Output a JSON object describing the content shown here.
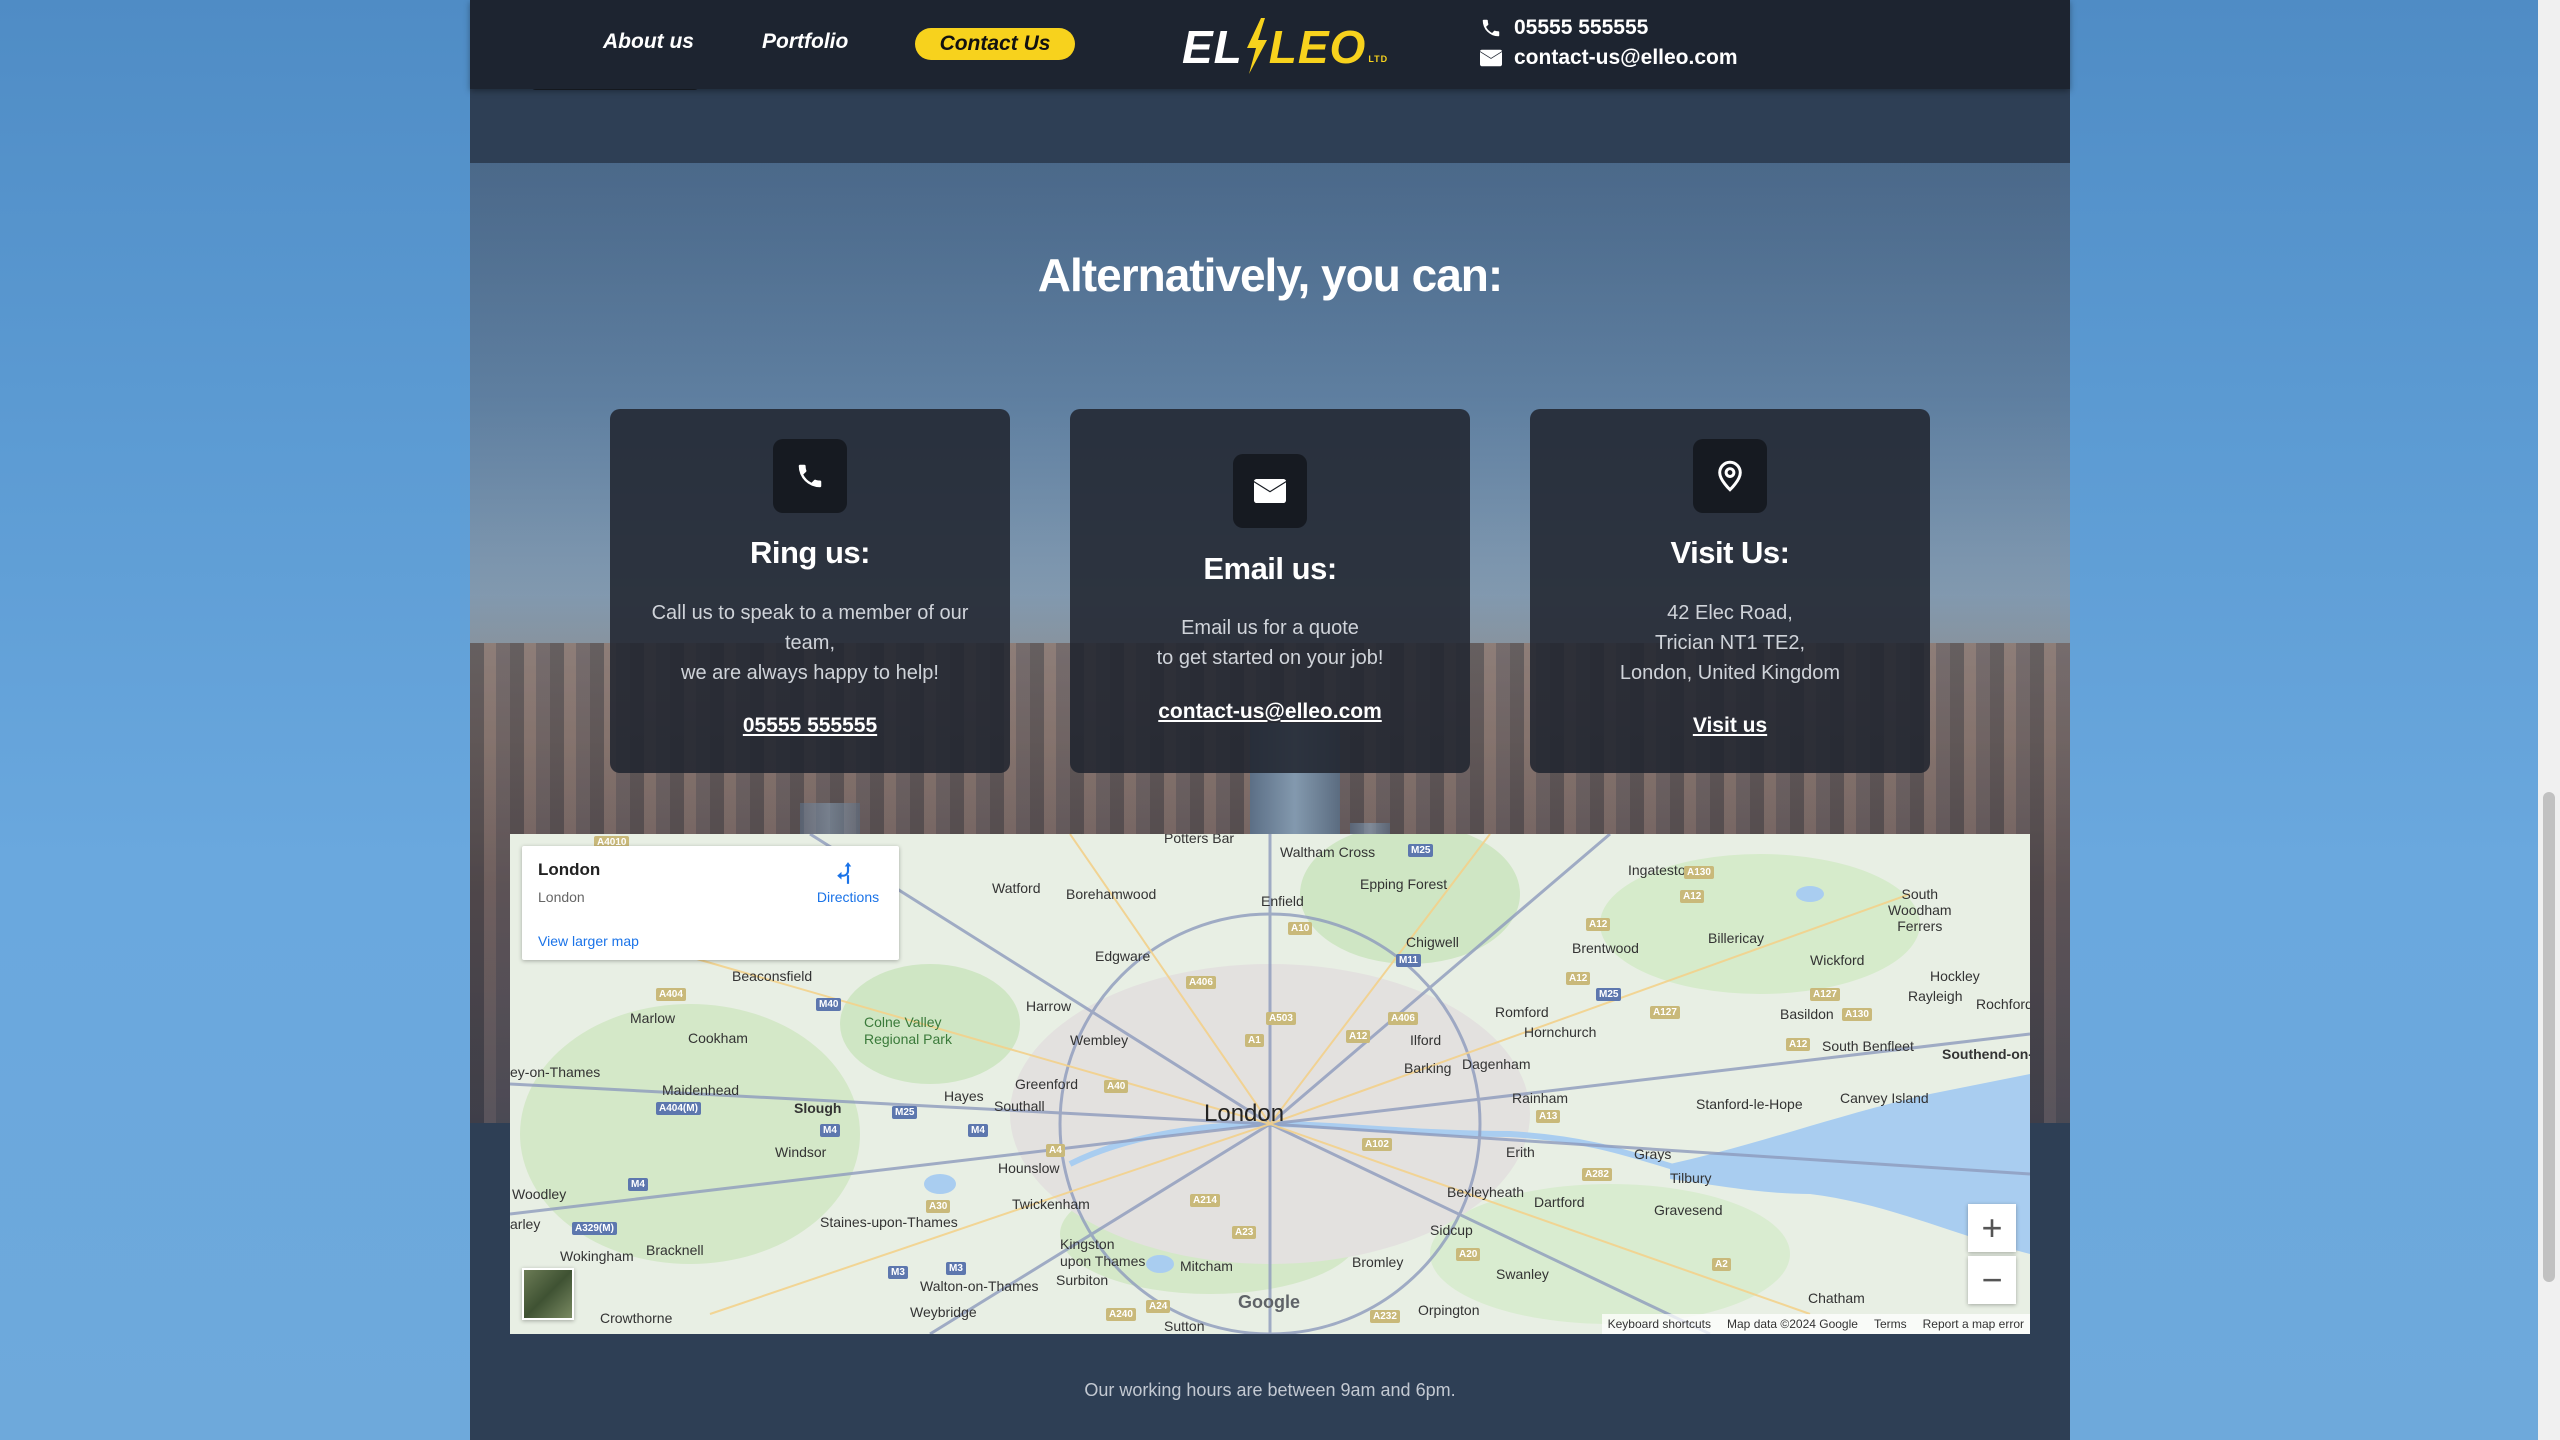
{
  "nav": {
    "about": "About us",
    "portfolio": "Portfolio",
    "contact": "Contact Us",
    "logo": {
      "left": "EL",
      "right": "LEO",
      "suffix": "LTD"
    },
    "phone": "05555 555555",
    "email": "contact-us@elleo.com"
  },
  "section": {
    "heading": "Alternatively, you can:"
  },
  "cards": [
    {
      "title": "Ring us:",
      "desc_lines": [
        "Call us to speak to a member of our",
        "team,",
        "we are always happy to help!"
      ],
      "link": "05555 555555",
      "icon": "phone-icon"
    },
    {
      "title": "Email us:",
      "desc_lines": [
        "Email us for a quote",
        "to get started on your job!"
      ],
      "link": "contact-us@elleo.com",
      "icon": "envelope-icon"
    },
    {
      "title": "Visit Us:",
      "desc_lines": [
        "42 Elec Road,",
        "Trician NT1 TE2,",
        "London, United Kingdom"
      ],
      "link": "Visit us",
      "icon": "map-pin-icon"
    }
  ],
  "map": {
    "place": "London",
    "place_sub": "London",
    "directions": "Directions",
    "view_larger": "View larger map",
    "zoom_in": "+",
    "zoom_out": "−",
    "footer": {
      "shortcuts": "Keyboard shortcuts",
      "data": "Map data ©2024 Google",
      "terms": "Terms",
      "report": "Report a map error"
    },
    "labels": [
      "Watford",
      "Borehamwood",
      "Enfield",
      "Waltham Cross",
      "Epping Forest",
      "Ingatestone",
      "South Woodham Ferrers",
      "Potters Bar",
      "Chigwell",
      "Brentwood",
      "Billericay",
      "Wickford",
      "Hockley",
      "Rayleigh",
      "Rochford",
      "Beaconsfield",
      "Edgware",
      "Harrow",
      "Wembley",
      "Romford",
      "Hornchurch",
      "Basildon",
      "South Benfleet",
      "Southend-on-Sea",
      "Marlow",
      "Cookham",
      "Colne Valley Regional Park",
      "Ilford",
      "Barking",
      "Dagenham",
      "Rainham",
      "Stanford-le-Hope",
      "Canvey Island",
      "Maidenhead",
      "Slough",
      "Hayes",
      "Greenford",
      "Southall",
      "London",
      "Erith",
      "Grays",
      "Tilbury",
      "Windsor",
      "Hounslow",
      "Bexleyheath",
      "Dartford",
      "Gravesend",
      "Woodley",
      "Twickenham",
      "Sidcup",
      "Wokingham",
      "Bracknell",
      "Staines-upon-Thames",
      "Kingston upon Thames",
      "Mitcham",
      "Bromley",
      "Swanley",
      "Walton-on-Thames",
      "Surbiton",
      "Weybridge",
      "Crowthorne",
      "Orpington",
      "Chatham",
      "Sutton",
      "Henley-on-Thames",
      "Farley"
    ],
    "google": "Google"
  },
  "footer": {
    "hours": "Our working hours are between 9am and 6pm."
  },
  "colors": {
    "accent": "#f7d21d",
    "navbar": "#1d2430",
    "card": "#212630",
    "link_blue": "#1a73e8"
  }
}
